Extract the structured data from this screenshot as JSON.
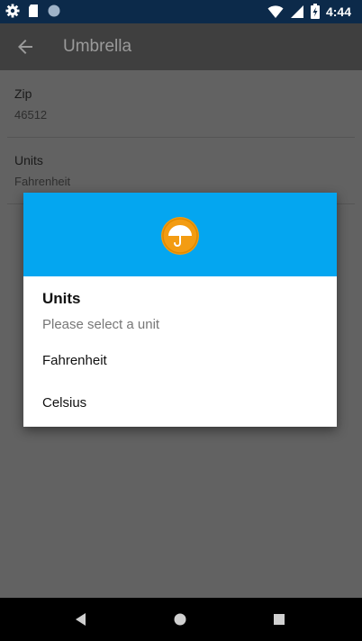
{
  "status_bar": {
    "time": "4:44",
    "icons_left": [
      "settings-icon",
      "sd-card-icon",
      "sync-icon"
    ],
    "icons_right": [
      "wifi-icon",
      "cell-signal-icon",
      "battery-charging-icon"
    ]
  },
  "app_bar": {
    "title": "Umbrella",
    "back_icon": "arrow-back-icon"
  },
  "preferences": [
    {
      "title": "Zip",
      "summary": "46512"
    },
    {
      "title": "Units",
      "summary": "Fahrenheit"
    }
  ],
  "dialog": {
    "header_color": "#04a6f0",
    "icon": "umbrella-icon",
    "title": "Units",
    "subtitle": "Please select a unit",
    "options": [
      "Fahrenheit",
      "Celsius"
    ]
  },
  "nav_bar": {
    "buttons": [
      "back-triangle-icon",
      "home-circle-icon",
      "recents-square-icon"
    ]
  },
  "colors": {
    "status_bar": "#0c2a4a",
    "accent": "#04a6f0",
    "icon_orange": "#f39c12"
  }
}
